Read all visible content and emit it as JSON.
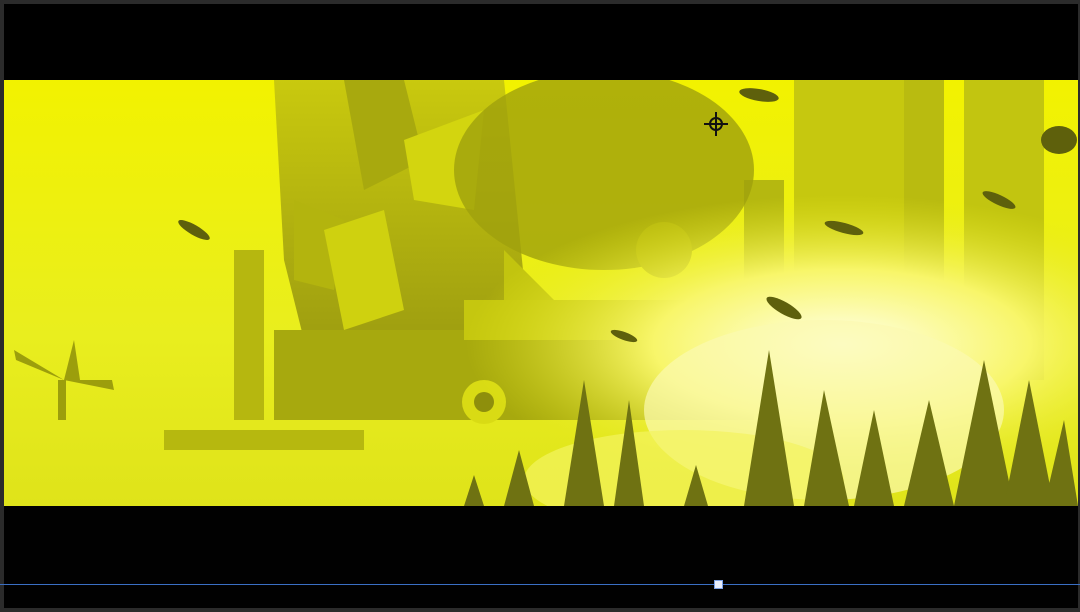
{
  "viewer": {
    "frame_icon": "image-frame",
    "crosshair_icon": "crosshair-icon",
    "playhead_icon": "playhead-handle"
  },
  "colors": {
    "tint": "#ffff00",
    "letterbox": "#000000",
    "timeline": "#3a6fc4",
    "background": "#2b2b2b"
  },
  "playback": {
    "playhead_position_fraction": 0.665
  }
}
